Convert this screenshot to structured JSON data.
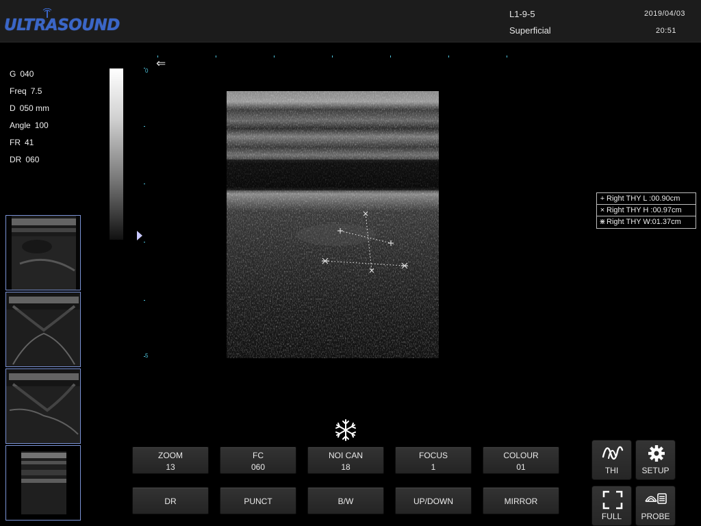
{
  "header": {
    "logo_text": "ULTRASOUND",
    "probe": "L1-9-5",
    "exam": "Superficial",
    "date": "2019/04/03",
    "time": "20:51"
  },
  "params": [
    {
      "label": "G",
      "value": "040"
    },
    {
      "label": "Freq",
      "value": "7.5"
    },
    {
      "label": "D",
      "value": "050 mm"
    },
    {
      "label": "Angle",
      "value": "100"
    },
    {
      "label": "FR",
      "value": "41"
    },
    {
      "label": "DR",
      "value": "060"
    }
  ],
  "depth_scale": {
    "top": "0",
    "bottom": "5"
  },
  "measurements": [
    {
      "symbol": "+",
      "text": "Right THY  L :00.90cm"
    },
    {
      "symbol": "×",
      "text": "Right THY  H :00.97cm"
    },
    {
      "symbol": "⋇",
      "text": "Right THY  W:01.37cm"
    }
  ],
  "controls_row1": [
    {
      "label": "ZOOM",
      "value": "13"
    },
    {
      "label": "FC",
      "value": "060"
    },
    {
      "label": "NOI CAN",
      "value": "18"
    },
    {
      "label": "FOCUS",
      "value": "1"
    },
    {
      "label": "COLOUR",
      "value": "01"
    }
  ],
  "controls_row2": [
    "DR",
    "PUNCT",
    "B/W",
    "UP/DOWN",
    "MIRROR"
  ],
  "side_buttons": {
    "thi": "THI",
    "setup": "SETUP",
    "full": "FULL",
    "probe": "PROBE"
  },
  "icons": {
    "freeze": "snowflake-icon",
    "thi": "wave-icon",
    "setup": "gear-icon",
    "full": "fullscreen-icon",
    "probe": "probe-icon",
    "orientation": "arrow-left-icon"
  },
  "colors": {
    "logo": "#3a66c8",
    "depth_scale": "#4fc6e0",
    "thumb_border": "#7b93d6"
  }
}
